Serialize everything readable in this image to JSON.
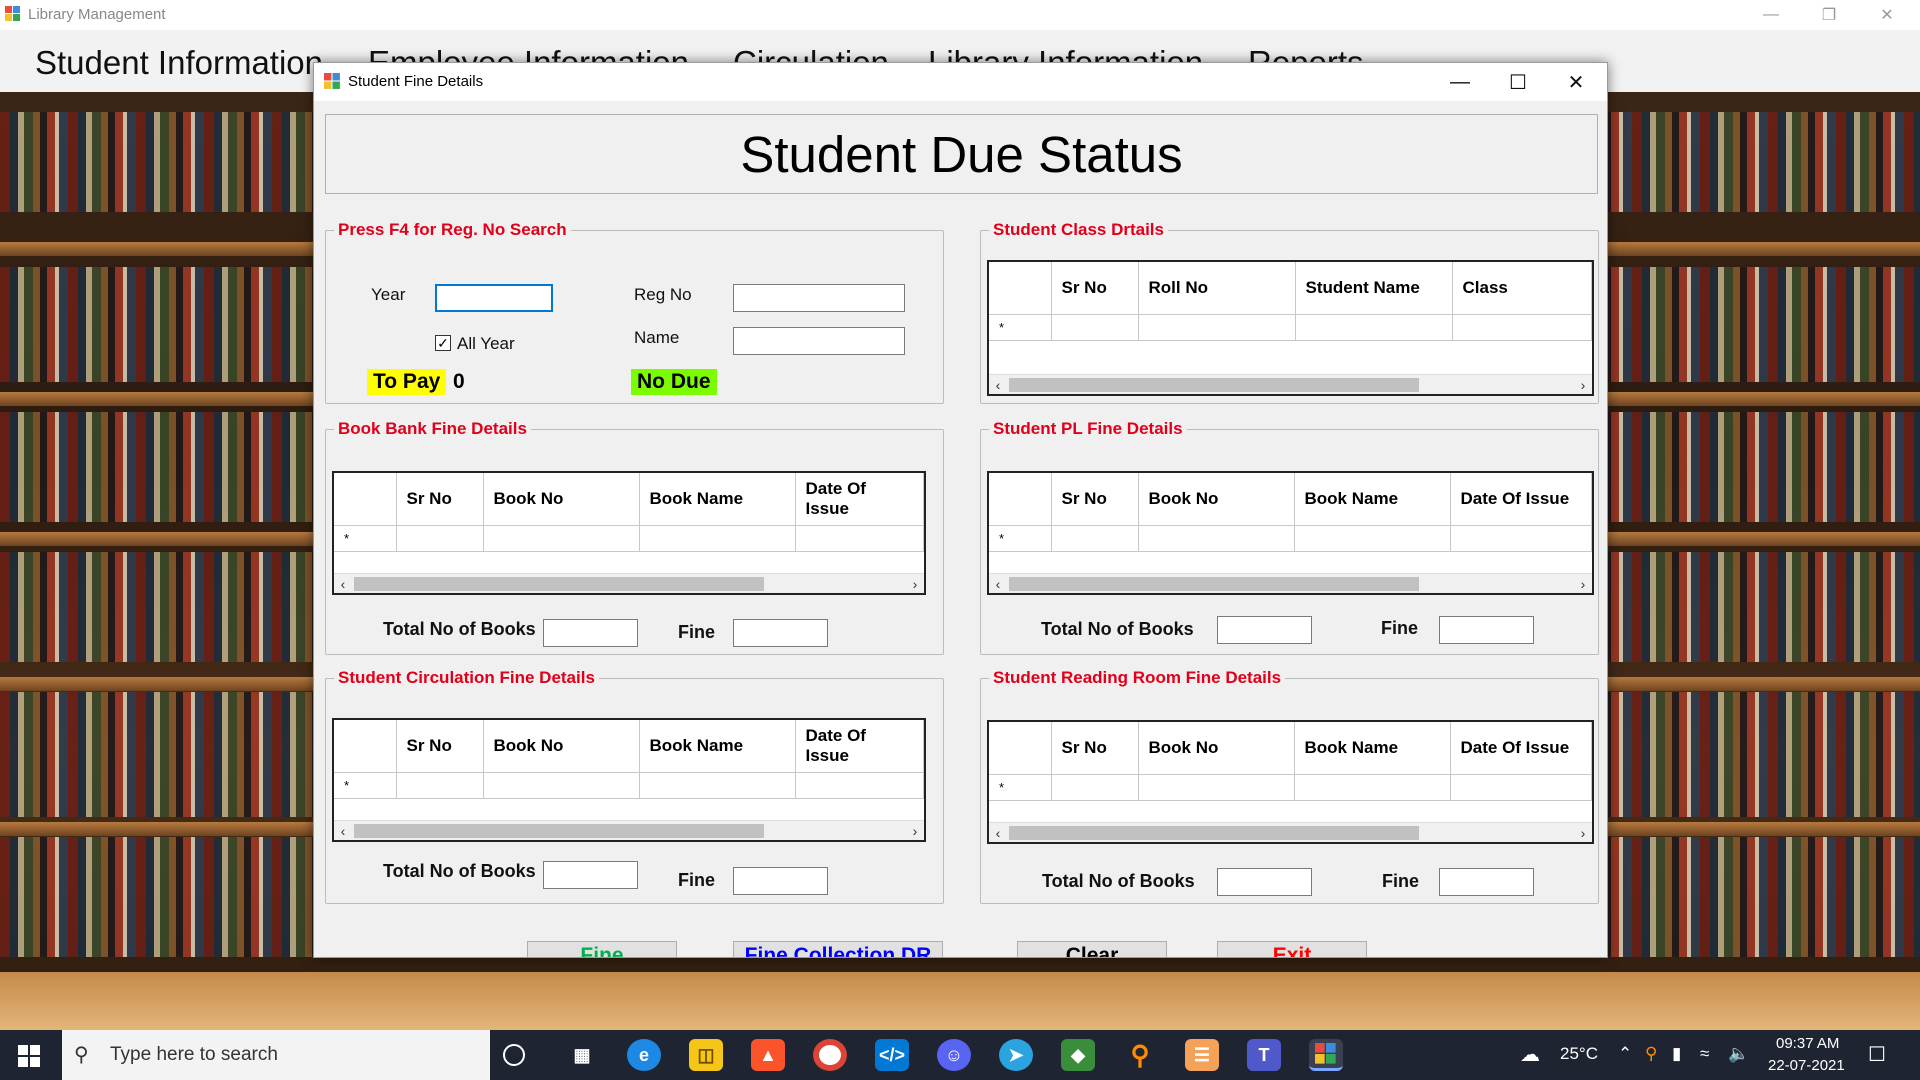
{
  "parent_window": {
    "title": "Library Management",
    "menu": [
      "Student Information",
      "Employee Information",
      "Circulation",
      "Library Information",
      "Reports"
    ]
  },
  "dialog": {
    "title": "Student Fine Details",
    "heading": "Student Due Status",
    "search_group": {
      "legend": "Press F4 for Reg. No Search",
      "year_label": "Year",
      "year_value": "",
      "all_year_label": "All Year",
      "all_year_checked": true,
      "regno_label": "Reg No",
      "regno_value": "",
      "name_label": "Name",
      "name_value": "",
      "to_pay_label": "To Pay",
      "to_pay_value": "0",
      "no_due_label": "No Due"
    },
    "class_group": {
      "legend": "Student Class Drtails",
      "columns": [
        "Sr No",
        "Roll No",
        "Student Name",
        "Class"
      ],
      "new_row_marker": "*"
    },
    "book_bank_group": {
      "legend": "Book Bank Fine Details",
      "columns": [
        "Sr No",
        "Book No",
        "Book Name",
        "Date Of Issue"
      ],
      "new_row_marker": "*",
      "total_books_label": "Total No of Books",
      "total_books_value": "",
      "fine_label": "Fine",
      "fine_value": ""
    },
    "pl_group": {
      "legend": "Student PL Fine Details",
      "columns": [
        "Sr No",
        "Book No",
        "Book Name",
        "Date Of Issue"
      ],
      "new_row_marker": "*",
      "total_books_label": "Total No of Books",
      "total_books_value": "",
      "fine_label": "Fine",
      "fine_value": ""
    },
    "circulation_group": {
      "legend": "Student Circulation Fine Details",
      "columns": [
        "Sr No",
        "Book No",
        "Book Name",
        "Date Of Issue"
      ],
      "new_row_marker": "*",
      "total_books_label": "Total No of Books",
      "total_books_value": "",
      "fine_label": "Fine",
      "fine_value": ""
    },
    "reading_room_group": {
      "legend": "Student Reading Room Fine Details",
      "columns": [
        "Sr No",
        "Book No",
        "Book Name",
        "Date Of Issue"
      ],
      "new_row_marker": "*",
      "total_books_label": "Total No of Books",
      "total_books_value": "",
      "fine_label": "Fine",
      "fine_value": ""
    },
    "buttons": {
      "fine": "Fine",
      "fine_collection": "Fine Collection DR",
      "clear": "Clear",
      "exit": "Exit"
    },
    "colors": {
      "legend_red": "#e0001b",
      "to_pay_bg": "#ffff00",
      "no_due_bg": "#7cfc00",
      "fine_btn_text": "#00b050",
      "fine_collection_btn_text": "#0000ff",
      "exit_btn_text": "#ff0000"
    }
  },
  "taskbar": {
    "search_placeholder": "Type here to search",
    "weather": "25°C",
    "time": "09:37 AM",
    "date": "22-07-2021",
    "apps": [
      "task-view-icon",
      "edge-icon",
      "file-explorer-icon",
      "brave-icon",
      "chrome-icon",
      "vscode-icon",
      "discord-icon",
      "telegram-icon",
      "git-icon",
      "search-tool-icon",
      "notepad-icon",
      "teams-icon",
      "library-app-icon"
    ]
  }
}
